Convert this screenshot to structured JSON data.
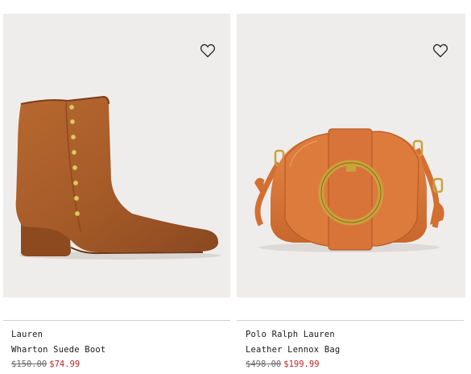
{
  "products": [
    {
      "brand": "Lauren",
      "name": "Wharton Suede Boot",
      "original_price": "$150.00",
      "sale_price": "$74.99",
      "favorite_icon": "heart-outline-icon"
    },
    {
      "brand": "Polo Ralph Lauren",
      "name": "Leather Lennox Bag",
      "original_price": "$498.00",
      "sale_price": "$199.99",
      "favorite_icon": "heart-outline-icon"
    }
  ],
  "colors": {
    "sale": "#c0262d",
    "image_background": "#efedec",
    "boot_suede": "#a45a28",
    "bag_leather": "#d9773a",
    "hardware_gold": "#c9a23c"
  }
}
